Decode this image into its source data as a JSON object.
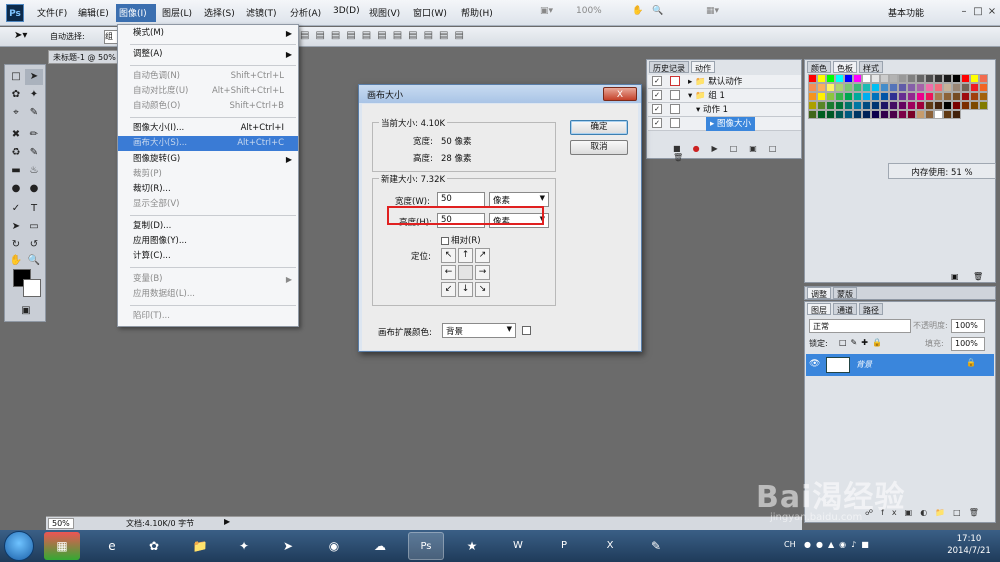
{
  "menubar": {
    "logo": "Ps",
    "items": [
      "文件(F)",
      "编辑(E)",
      "图像(I)",
      "图层(L)",
      "选择(S)",
      "滤镜(T)",
      "分析(A)",
      "3D(D)",
      "视图(V)",
      "窗口(W)",
      "帮助(H)"
    ],
    "zoom": "100%",
    "workspace": "基本功能",
    "minimize": "–",
    "maximize": "□",
    "close": "×"
  },
  "options_bar": {
    "auto_select_label": "自动选择:",
    "auto_select_value": "组"
  },
  "document": {
    "tab_title": "未标题-1 @ 50%",
    "zoom": "50%",
    "doc_info": "文档:4.10K/0 字节"
  },
  "image_menu": {
    "items": [
      {
        "label": "模式(M)",
        "shortcut": "",
        "submenu": true,
        "disabled": false
      },
      {
        "label": "调整(A)",
        "shortcut": "",
        "submenu": true,
        "disabled": false
      },
      {
        "label": "自动色调(N)",
        "shortcut": "Shift+Ctrl+L",
        "submenu": false,
        "disabled": true
      },
      {
        "label": "自动对比度(U)",
        "shortcut": "Alt+Shift+Ctrl+L",
        "submenu": false,
        "disabled": true
      },
      {
        "label": "自动颜色(O)",
        "shortcut": "Shift+Ctrl+B",
        "submenu": false,
        "disabled": true
      },
      {
        "label": "图像大小(I)...",
        "shortcut": "Alt+Ctrl+I",
        "submenu": false,
        "disabled": false
      },
      {
        "label": "画布大小(S)...",
        "shortcut": "Alt+Ctrl+C",
        "submenu": false,
        "disabled": false,
        "highlighted": true
      },
      {
        "label": "图像旋转(G)",
        "shortcut": "",
        "submenu": true,
        "disabled": false
      },
      {
        "label": "裁剪(P)",
        "shortcut": "",
        "submenu": false,
        "disabled": true
      },
      {
        "label": "裁切(R)...",
        "shortcut": "",
        "submenu": false,
        "disabled": false
      },
      {
        "label": "显示全部(V)",
        "shortcut": "",
        "submenu": false,
        "disabled": true
      },
      {
        "label": "复制(D)...",
        "shortcut": "",
        "submenu": false,
        "disabled": false
      },
      {
        "label": "应用图像(Y)...",
        "shortcut": "",
        "submenu": false,
        "disabled": false
      },
      {
        "label": "计算(C)...",
        "shortcut": "",
        "submenu": false,
        "disabled": false
      },
      {
        "label": "变量(B)",
        "shortcut": "",
        "submenu": true,
        "disabled": true
      },
      {
        "label": "应用数据组(L)...",
        "shortcut": "",
        "submenu": false,
        "disabled": true
      },
      {
        "label": "陷印(T)...",
        "shortcut": "",
        "submenu": false,
        "disabled": true
      }
    ]
  },
  "dialog": {
    "title": "画布大小",
    "close": "X",
    "current_size_legend": "当前大小: 4.10K",
    "current_width_label": "宽度:",
    "current_width_value": "50 像素",
    "current_height_label": "高度:",
    "current_height_value": "28 像素",
    "new_size_legend": "新建大小: 7.32K",
    "width_label": "宽度(W):",
    "width_value": "50",
    "width_unit": "像素",
    "height_label": "高度(H):",
    "height_value": "50",
    "height_unit": "像素",
    "relative_label": "相对(R)",
    "anchor_label": "定位:",
    "anchor_arrows": [
      "↖",
      "↑",
      "↗",
      "←",
      "",
      "→",
      "↙",
      "↓",
      "↘"
    ],
    "ext_color_label": "画布扩展颜色:",
    "ext_color_value": "背景",
    "ok": "确定",
    "cancel": "取消"
  },
  "actions_panel": {
    "tabs": [
      "历史记录",
      "动作"
    ],
    "rows": [
      {
        "label": "默认动作",
        "indent": 0
      },
      {
        "label": "组 1",
        "indent": 0
      },
      {
        "label": "动作 1",
        "indent": 1
      },
      {
        "label": "图像大小",
        "indent": 2,
        "selected": true
      }
    ]
  },
  "swatches_panel": {
    "tabs": [
      "颜色",
      "色板",
      "样式"
    ],
    "memory": "内存使用: 51 %"
  },
  "adjust_panel": {
    "tabs": [
      "调整",
      "蒙版"
    ]
  },
  "layers_panel": {
    "tabs": [
      "图层",
      "通道",
      "路径"
    ],
    "blend_mode": "正常",
    "opacity_label": "不透明度:",
    "opacity_value": "100%",
    "lock_label": "锁定:",
    "fill_label": "填充:",
    "fill_value": "100%",
    "layer_name": "背景"
  },
  "taskbar": {
    "lang": "CH",
    "time": "17:10",
    "date": "2014/7/21"
  },
  "watermark": {
    "main": "Bai渴经验",
    "sub": "jingyan.baidu.com"
  },
  "colors": {
    "menu_highlight": "#3a7bd5",
    "selection": "#3a86dc",
    "highlight_box": "#e02020"
  }
}
